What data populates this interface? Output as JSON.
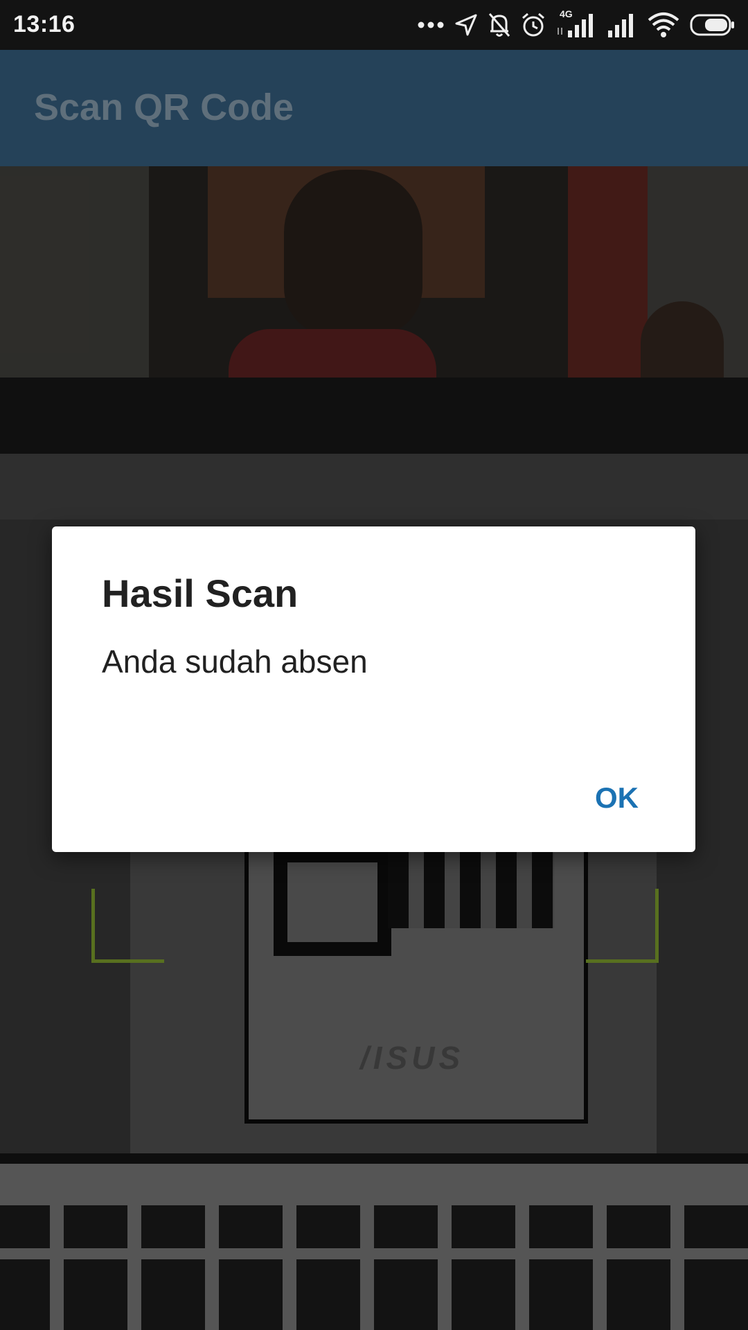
{
  "status_bar": {
    "time": "13:16",
    "network_label": "4G",
    "icons": [
      "more-dots-icon",
      "location-arrow-icon",
      "notifications-off-icon",
      "alarm-icon",
      "signal-4g-icon",
      "signal-icon",
      "wifi-icon",
      "battery-icon"
    ]
  },
  "app_bar": {
    "title": "Scan QR Code",
    "background_color": "#254259"
  },
  "camera_preview": {
    "logo_text": "/ISUS"
  },
  "scanner": {
    "bracket_color": "#58701f"
  },
  "dialog": {
    "title": "Hasil Scan",
    "message": "Anda sudah absen",
    "ok_label": "OK",
    "accent_color": "#1b72b3"
  }
}
